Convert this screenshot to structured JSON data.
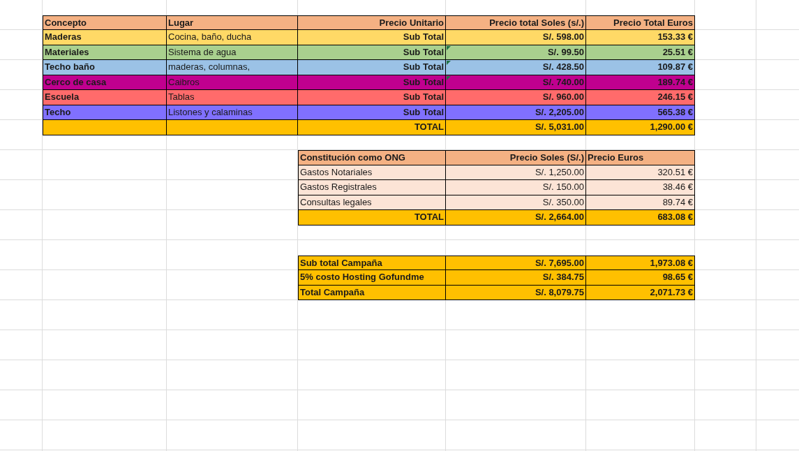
{
  "cost_table": {
    "columns": [
      "Concepto",
      "Lugar",
      "Precio Unitario",
      "Precio total Soles (s/.)",
      "Precio Total Euros"
    ],
    "rows": [
      {
        "concepto": "Maderas",
        "lugar": "Cocina, baño, ducha",
        "precio_unitario": "Sub Total",
        "soles": "S/. 598.00",
        "euros": "153.33 €",
        "color": "#ffd966",
        "error_flag": false
      },
      {
        "concepto": "Materiales",
        "lugar": "Sistema de agua",
        "precio_unitario": "Sub Total",
        "soles": "S/. 99.50",
        "euros": "25.51 €",
        "color": "#a9d08e",
        "error_flag": true
      },
      {
        "concepto": "Techo baño",
        "lugar": "maderas, columnas,",
        "precio_unitario": "Sub Total",
        "soles": "S/. 428.50",
        "euros": "109.87 €",
        "color": "#9bc2e6",
        "error_flag": true
      },
      {
        "concepto": "Cerco de casa",
        "lugar": "Caibros",
        "precio_unitario": "Sub Total",
        "soles": "S/. 740.00",
        "euros": "189.74 €",
        "color": "#c0008f",
        "error_flag": true
      },
      {
        "concepto": "Escuela",
        "lugar": "Tablas",
        "precio_unitario": "Sub Total",
        "soles": "S/. 960.00",
        "euros": "246.15 €",
        "color": "#ff6b6b",
        "error_flag": false
      },
      {
        "concepto": "Techo",
        "lugar": "Listones y calaminas",
        "precio_unitario": "Sub Total",
        "soles": "S/. 2,205.00",
        "euros": "565.38 €",
        "color": "#8070ff",
        "error_flag": false
      }
    ],
    "total": {
      "label": "TOTAL",
      "soles": "S/. 5,031.00",
      "euros": "1,290.00 €"
    }
  },
  "ong_table": {
    "columns": [
      "Constitución como ONG",
      "Precio Soles (S/.)",
      "Precio Euros"
    ],
    "rows": [
      {
        "concepto": "Gastos Notariales",
        "soles": "S/. 1,250.00",
        "euros": "320.51 €"
      },
      {
        "concepto": "Gastos Registrales",
        "soles": "S/. 150.00",
        "euros": "38.46 €"
      },
      {
        "concepto": "Consultas legales",
        "soles": "S/. 350.00",
        "euros": "89.74 €"
      }
    ],
    "total": {
      "label": "TOTAL",
      "soles": "S/. 2,664.00",
      "euros": "683.08 €"
    }
  },
  "campaign_table": {
    "rows": [
      {
        "label": "Sub total Campaña",
        "soles": "S/. 7,695.00",
        "euros": "1,973.08 €"
      },
      {
        "label": "5% costo Hosting Gofundme",
        "soles": "S/. 384.75",
        "euros": "98.65 €"
      },
      {
        "label": "Total Campaña",
        "soles": "S/. 8,079.75",
        "euros": "2,071.73 €"
      }
    ]
  }
}
